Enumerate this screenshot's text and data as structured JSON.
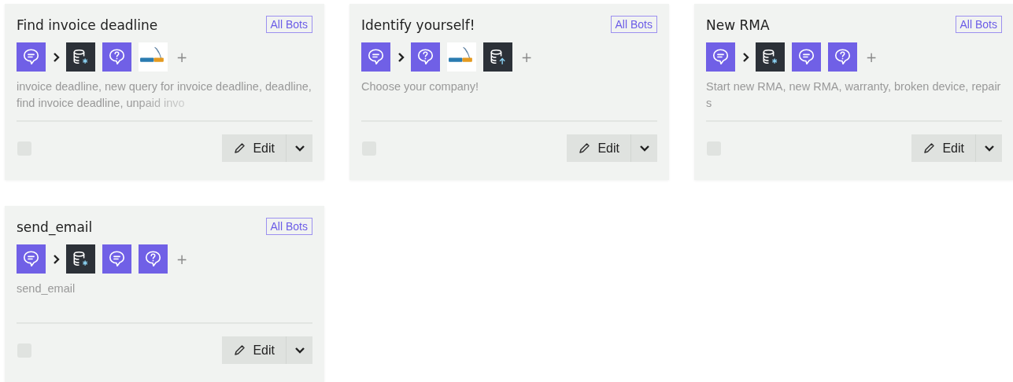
{
  "cards": [
    {
      "title": "Find invoice deadline",
      "scope": "All Bots",
      "trigger": {
        "kind": "message"
      },
      "steps": [
        {
          "kind": "database-query"
        },
        {
          "kind": "question"
        },
        {
          "kind": "mysql"
        }
      ],
      "add_label": "+",
      "description": {
        "text": "invoice deadline, new query for invoice deadline, deadline, find invoice deadline, unpaid invo",
        "faded": true
      },
      "checked": false,
      "edit_label": "Edit"
    },
    {
      "title": "Identify yourself!",
      "scope": "All Bots",
      "trigger": {
        "kind": "message"
      },
      "steps": [
        {
          "kind": "question"
        },
        {
          "kind": "mysql"
        },
        {
          "kind": "database-upload"
        }
      ],
      "add_label": "+",
      "description": {
        "text": "Choose your company!"
      },
      "checked": false,
      "edit_label": "Edit"
    },
    {
      "title": "New RMA",
      "scope": "All Bots",
      "trigger": {
        "kind": "message"
      },
      "steps": [
        {
          "kind": "database-query"
        },
        {
          "kind": "message"
        },
        {
          "kind": "question"
        }
      ],
      "add_label": "+",
      "description": {
        "text": "Start new RMA, new RMA, warranty, broken device, repairs"
      },
      "checked": false,
      "edit_label": "Edit"
    },
    {
      "title": "send_email",
      "scope": "All Bots",
      "trigger": {
        "kind": "message"
      },
      "steps": [
        {
          "kind": "database-query"
        },
        {
          "kind": "message"
        },
        {
          "kind": "question"
        }
      ],
      "add_label": "+",
      "description": {
        "text": "send_email"
      },
      "checked": false,
      "edit_label": "Edit"
    }
  ]
}
